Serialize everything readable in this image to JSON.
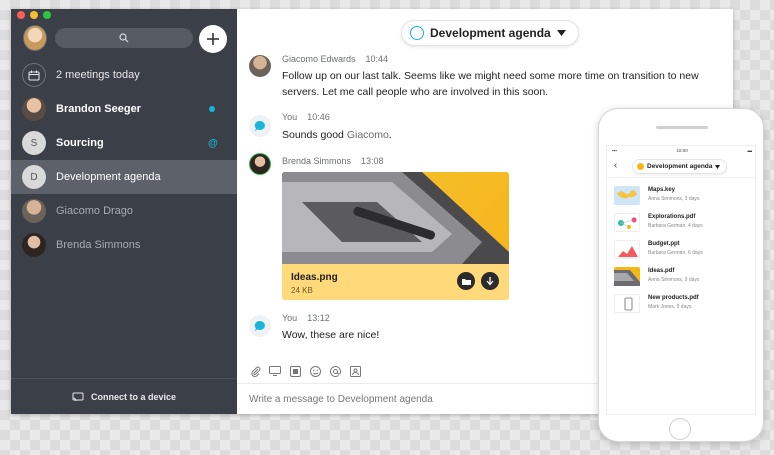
{
  "sidebar": {
    "search_icon": "search-icon",
    "add_icon": "plus-icon",
    "items": [
      {
        "label": "2 meetings today",
        "icon": "calendar-icon"
      },
      {
        "label": "Brandon Seeger",
        "badge_color": "#17b5d9"
      },
      {
        "label": "Sourcing",
        "initial": "S",
        "badge": "@",
        "badge_color": "#17b5d9"
      },
      {
        "label": "Development agenda",
        "initial": "D"
      },
      {
        "label": "Giacomo Drago"
      },
      {
        "label": "Brenda Simmons"
      }
    ],
    "connect_label": "Connect to a device"
  },
  "header": {
    "title": "Development agenda"
  },
  "messages": [
    {
      "author": "Giacomo Edwards",
      "time": "10:44",
      "text": "Follow up on our last talk. Seems like we might need some more time on transition to new servers. Let me call people who are involved in this soon."
    },
    {
      "author": "You",
      "time": "10:46",
      "text_prefix": "Sounds good ",
      "text_highlight": "Giacomo",
      "text_suffix": "."
    },
    {
      "author": "Brenda Simmons",
      "time": "13:08",
      "attachment": {
        "name": "Ideas.png",
        "size": "24 KB"
      }
    },
    {
      "author": "You",
      "time": "13:12",
      "text": "Wow, these are nice!"
    }
  ],
  "composer": {
    "placeholder": "Write a message to Development agenda",
    "tools": [
      "paperclip-icon",
      "screen-share-icon",
      "gif-icon",
      "emoji-icon",
      "mention-icon",
      "whiteboard-icon"
    ]
  },
  "phone": {
    "time": "18:00",
    "title": "Development agenda",
    "files": [
      {
        "name": "Maps.key",
        "sub": "Anna Simmons, 3 days"
      },
      {
        "name": "Explorations.pdf",
        "sub": "Barbara German, 4 days"
      },
      {
        "name": "Budget.ppt",
        "sub": "Barbara German, 6 days"
      },
      {
        "name": "Ideas.pdf",
        "sub": "Anna Simmons, 9 days"
      },
      {
        "name": "New products.pdf",
        "sub": "Mark Jones, 9 days"
      }
    ]
  },
  "colors": {
    "sidebar_bg": "#3b3f47",
    "sidebar_active": "#5d6169",
    "accent": "#17b5d9",
    "attachment": "#ffd45a"
  }
}
